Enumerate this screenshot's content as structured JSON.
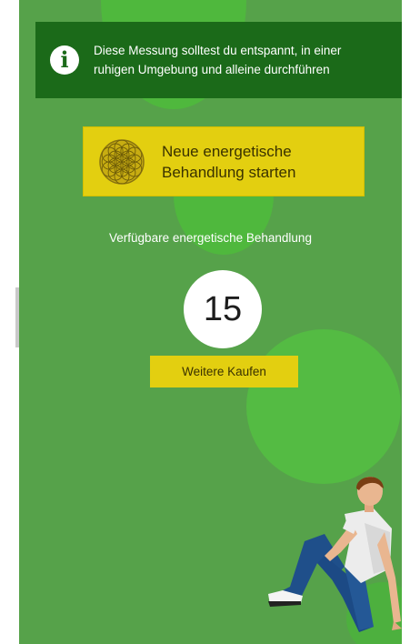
{
  "info": {
    "icon": "info-icon",
    "glyph": "i",
    "text_line1": "Diese Messung solltest du entspannt, in einer",
    "text_line2": "ruhigen Umgebung und alleine durchführen"
  },
  "start_button": {
    "icon": "flower-of-life-icon",
    "label_line1": "Neue energetische",
    "label_line2": "Behandlung starten"
  },
  "available": {
    "caption": "Verfügbare energetische Behandlung",
    "count": "15"
  },
  "buy_button": {
    "label": "Weitere Kaufen"
  },
  "illustration": {
    "icon": "sitting-person-illustration"
  },
  "colors": {
    "background": "#56a24a",
    "circles": "#4fb83d",
    "banner": "#1b6a19",
    "accent_yellow": "#e3cf10"
  }
}
